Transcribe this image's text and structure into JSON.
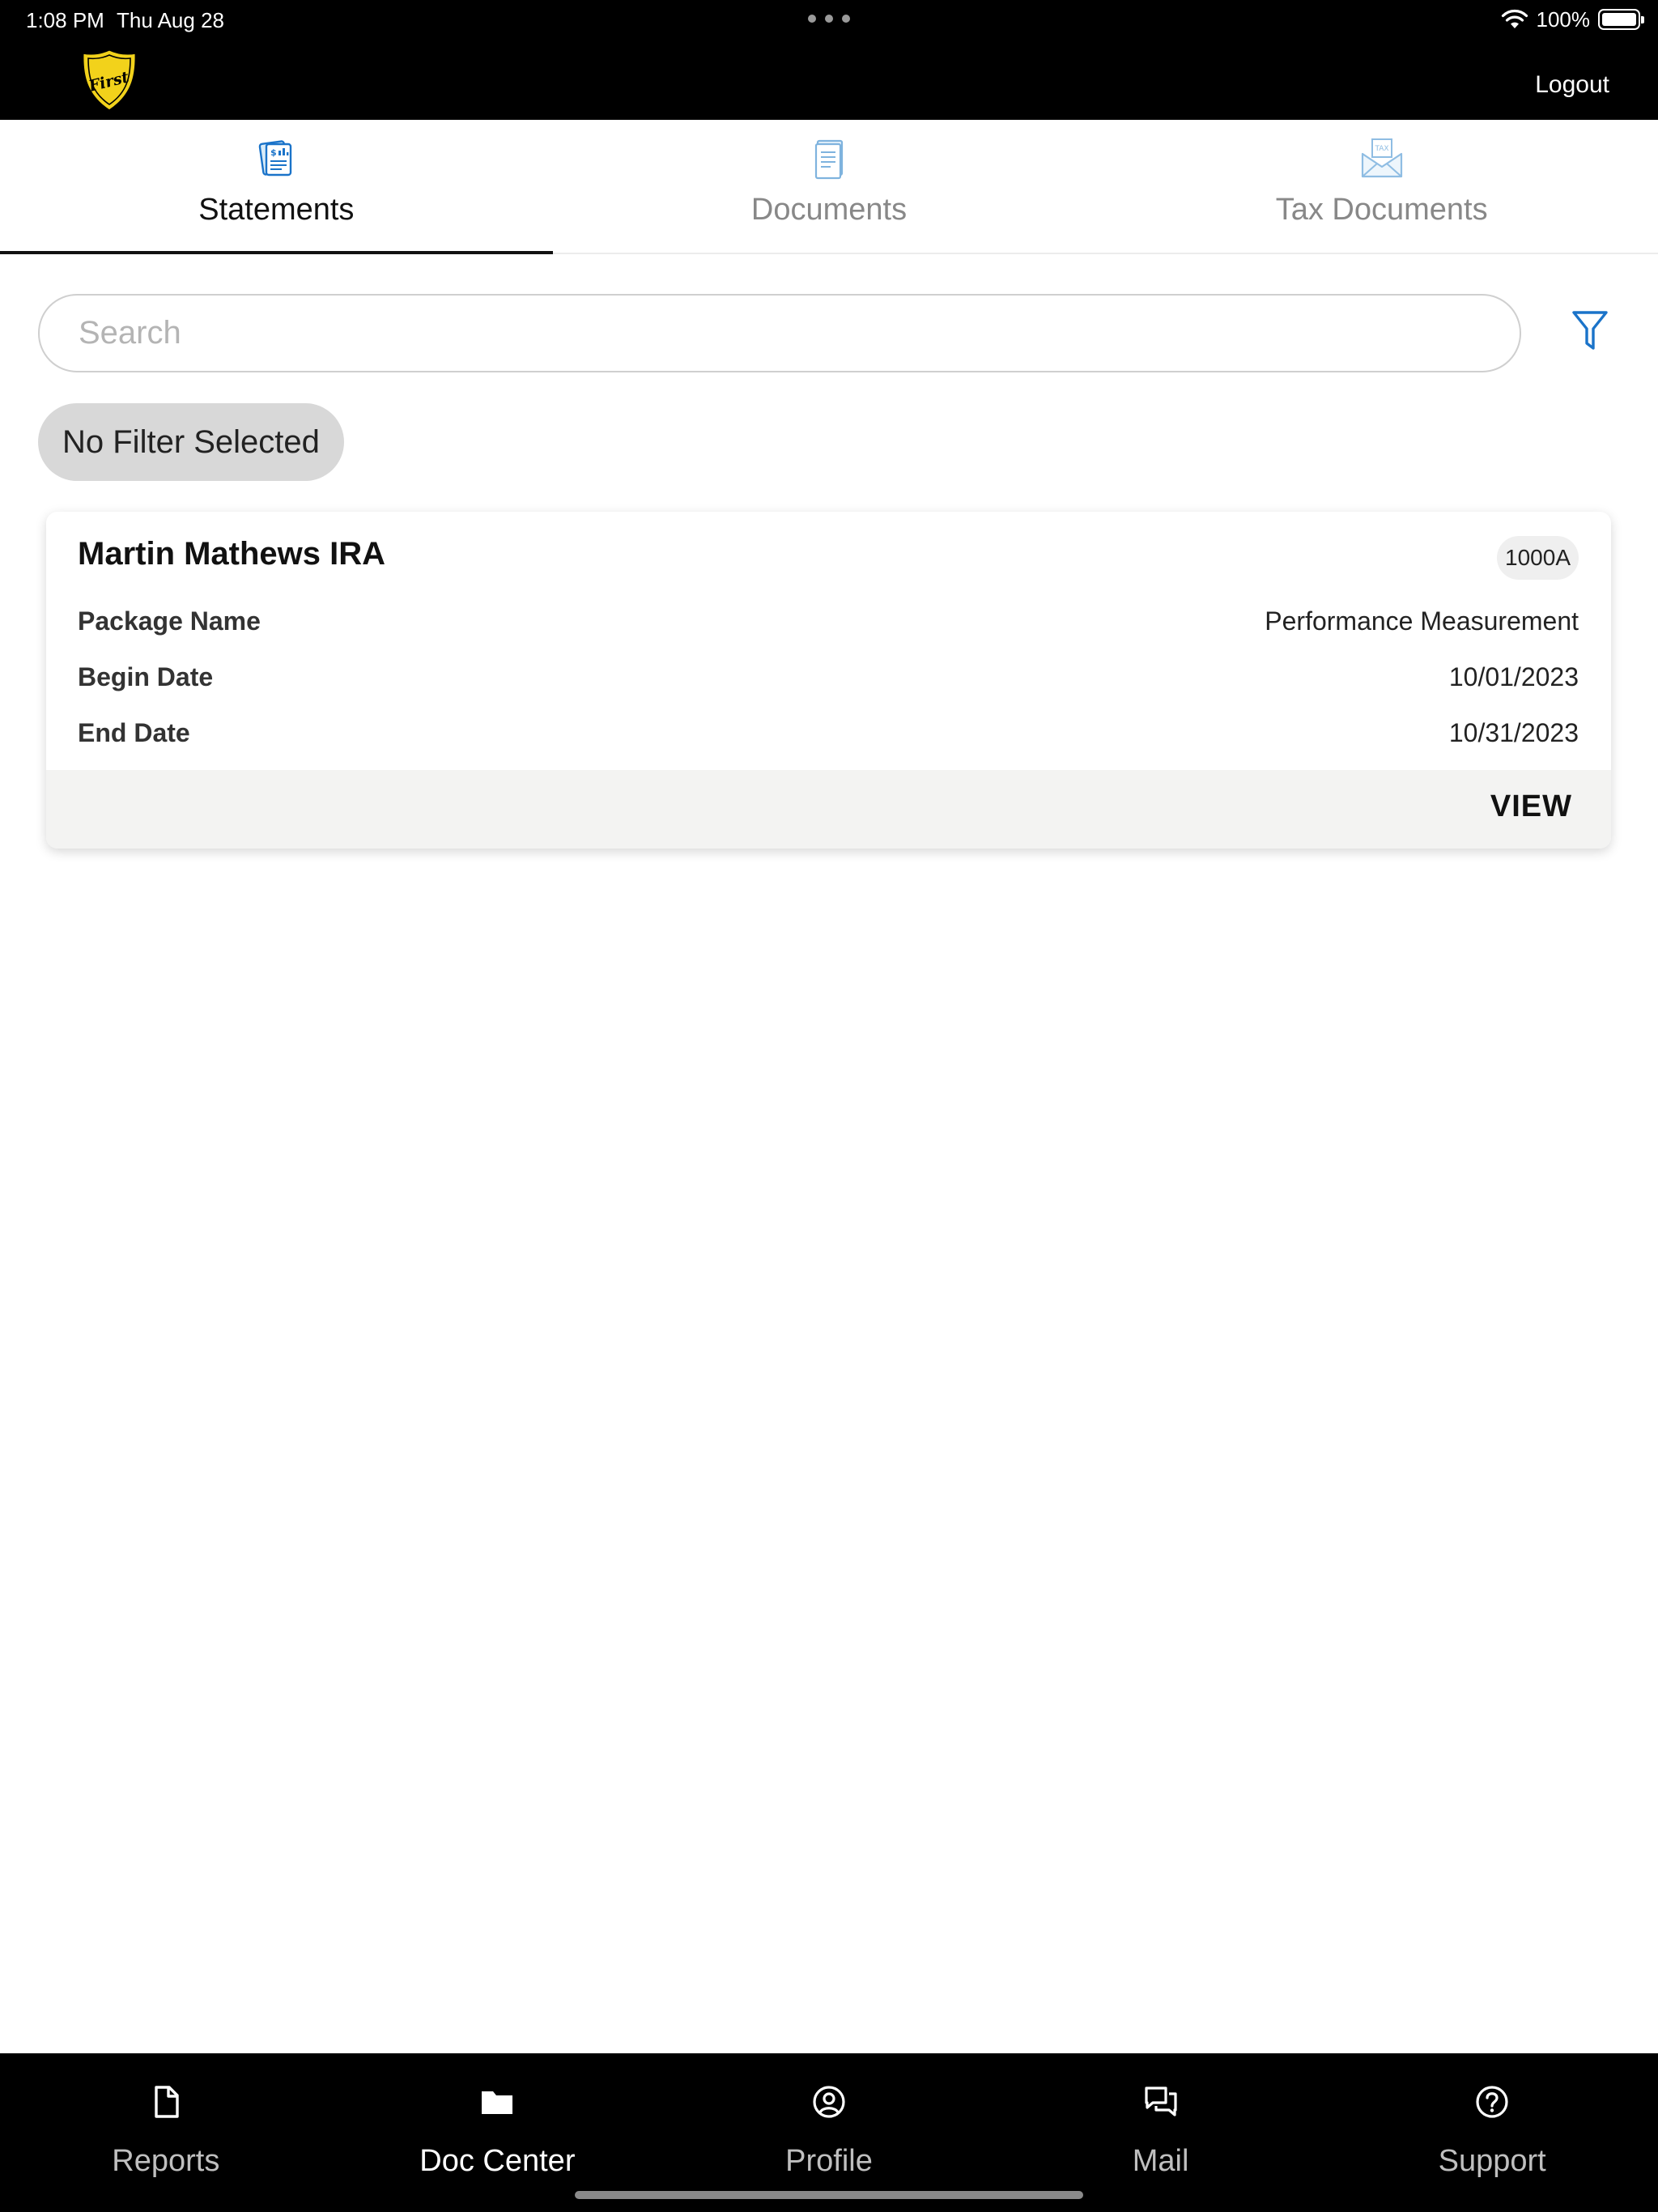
{
  "status_bar": {
    "time": "1:08 PM",
    "date": "Thu Aug 28",
    "battery": "100%"
  },
  "header": {
    "logo_icon": "first-shield-logo",
    "logout_label": "Logout"
  },
  "tabs": [
    {
      "label": "Statements",
      "icon": "statement-icon",
      "active": true
    },
    {
      "label": "Documents",
      "icon": "document-icon",
      "active": false
    },
    {
      "label": "Tax Documents",
      "icon": "tax-envelope-icon",
      "active": false
    }
  ],
  "search": {
    "placeholder": "Search",
    "value": ""
  },
  "filter_chip": "No Filter Selected",
  "card": {
    "title": "Martin Mathews IRA",
    "badge": "1000A",
    "rows": [
      {
        "label": "Package Name",
        "value": "Performance Measurement"
      },
      {
        "label": "Begin Date",
        "value": "10/01/2023"
      },
      {
        "label": "End Date",
        "value": "10/31/2023"
      }
    ],
    "action_label": "VIEW"
  },
  "bottom_nav": [
    {
      "label": "Reports",
      "icon": "file-icon",
      "active": false
    },
    {
      "label": "Doc Center",
      "icon": "folder-icon",
      "active": true
    },
    {
      "label": "Profile",
      "icon": "profile-icon",
      "active": false
    },
    {
      "label": "Mail",
      "icon": "chat-icon",
      "active": false
    },
    {
      "label": "Support",
      "icon": "help-icon",
      "active": false
    }
  ],
  "colors": {
    "accent_blue": "#1a73c9",
    "logo_yellow": "#f2d21b",
    "header_bg": "#000000"
  }
}
